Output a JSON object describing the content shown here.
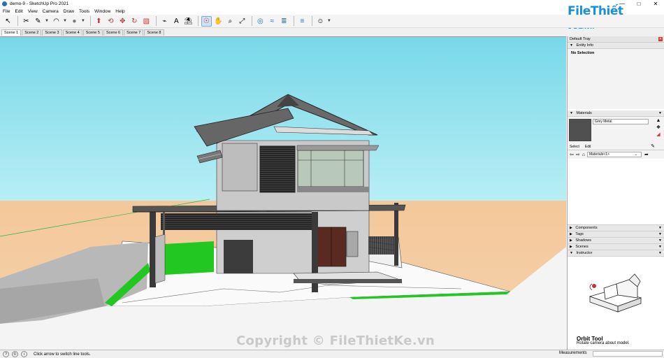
{
  "window": {
    "title": "demo-9 - SketchUp Pro 2021",
    "controls": [
      "—",
      "□",
      "✕"
    ]
  },
  "menu": [
    "File",
    "Edit",
    "View",
    "Camera",
    "Draw",
    "Tools",
    "Window",
    "Help"
  ],
  "toolbar": {
    "tools": [
      {
        "name": "select-tool-icon",
        "glyph": "↖"
      },
      {
        "name": "eraser-tool-icon",
        "glyph": "✂"
      },
      {
        "name": "line-tool-icon",
        "glyph": "✎"
      },
      {
        "name": "arc-tool-icon",
        "glyph": "◠"
      },
      {
        "name": "shape-tool-icon",
        "glyph": "●"
      },
      {
        "name": "push-pull-tool-icon",
        "glyph": "⬆"
      },
      {
        "name": "offset-tool-icon",
        "glyph": "⟲"
      },
      {
        "name": "move-tool-icon",
        "glyph": "✥"
      },
      {
        "name": "rotate-tool-icon",
        "glyph": "↻"
      },
      {
        "name": "scale-tool-icon",
        "glyph": "▨"
      },
      {
        "name": "tape-measure-icon",
        "glyph": "⌁"
      },
      {
        "name": "text-tool-icon",
        "glyph": "A"
      },
      {
        "name": "paint-bucket-icon",
        "glyph": "⛱"
      },
      {
        "name": "orbit-tool-icon",
        "glyph": "☉"
      },
      {
        "name": "pan-tool-icon",
        "glyph": "✋"
      },
      {
        "name": "zoom-tool-icon",
        "glyph": "⌕"
      },
      {
        "name": "zoom-extents-icon",
        "glyph": "⤢"
      },
      {
        "name": "warehouse-icon",
        "glyph": "◎"
      },
      {
        "name": "extension-warehouse-icon",
        "glyph": "≈"
      },
      {
        "name": "layout-send-icon",
        "glyph": "≣"
      },
      {
        "name": "extension-manager-icon",
        "glyph": "≡"
      },
      {
        "name": "account-icon",
        "glyph": "☺"
      }
    ]
  },
  "scenes": [
    "Scene 1",
    "Scene 2",
    "Scene 3",
    "Scene 4",
    "Scene 5",
    "Scene 6",
    "Scene 7",
    "Scene 8"
  ],
  "tray": {
    "title": "Default Tray",
    "entity_info": {
      "header": "Entity Info",
      "selection": "No Selection"
    },
    "materials": {
      "header": "Materials",
      "name": "Grey Metal",
      "swatch_color": "#505050",
      "tabs": [
        "Select",
        "Edit"
      ],
      "library": "Materials<1>"
    },
    "collapsed": [
      "Components",
      "Tags",
      "Shadows",
      "Scenes"
    ],
    "instructor": {
      "header": "Instructor",
      "tool_name": "Orbit Tool",
      "tool_desc": "Rotate camera about model."
    }
  },
  "status": {
    "hint": "Click arrow to switch line tools.",
    "measurements_label": "Measurements"
  },
  "branding": {
    "logo": "FileThiết Kế",
    "logo_suffix": ".vn",
    "watermark": "Copyright © FileThietKe.vn"
  },
  "colors": {
    "sky": "#7ad6e6",
    "ground": "#f0c99a",
    "grass": "#22cc22",
    "accent": "#1a8fd6"
  }
}
